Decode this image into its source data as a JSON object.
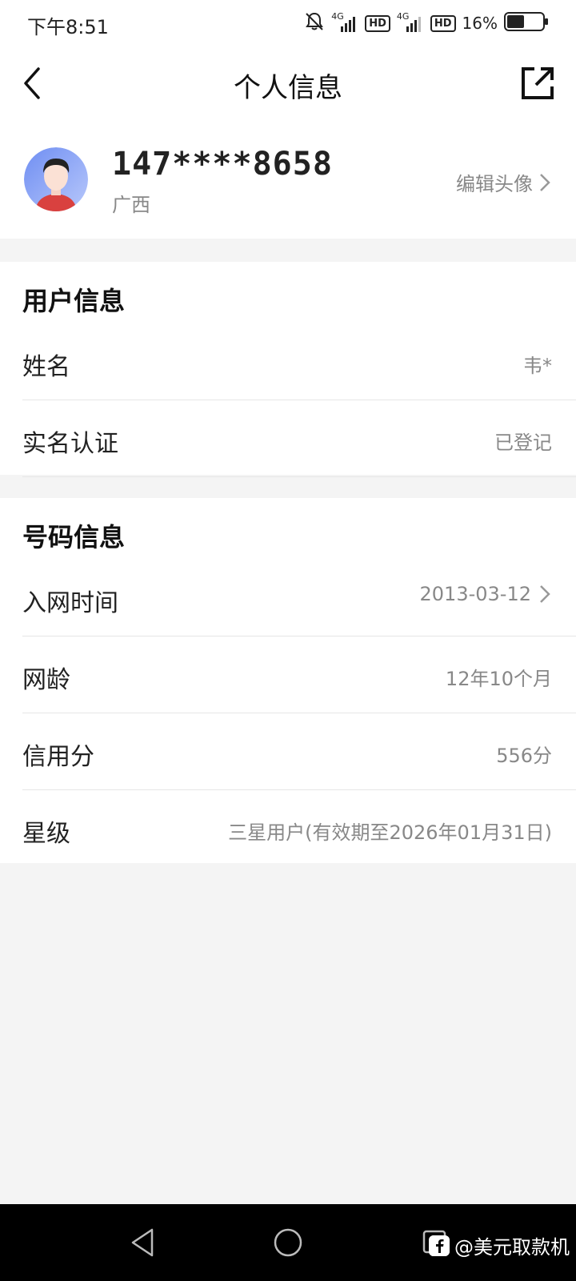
{
  "status_bar": {
    "time": "下午8:51",
    "battery_percent": "16%",
    "network_1": "4G",
    "network_2": "4G",
    "hd_1": "HD",
    "hd_2": "HD",
    "battery_level": 0.16
  },
  "header": {
    "title": "个人信息"
  },
  "profile": {
    "phone": "147****8658",
    "region": "广西",
    "edit_avatar_label": "编辑头像"
  },
  "user_info": {
    "title": "用户信息",
    "rows": [
      {
        "label": "姓名",
        "value": "韦*"
      },
      {
        "label": "实名认证",
        "value": "已登记"
      }
    ]
  },
  "number_info": {
    "title": "号码信息",
    "rows": [
      {
        "label": "入网时间",
        "value": "2013-03-12",
        "has_chevron": true
      },
      {
        "label": "网龄",
        "value": "12年10个月"
      },
      {
        "label": "信用分",
        "value": "556分"
      },
      {
        "label": "星级",
        "value": "三星用户(有效期至2026年01月31日)"
      }
    ]
  },
  "watermark": {
    "text": "@美元取款机"
  },
  "icons": [
    "back-arrow-icon",
    "share-icon",
    "chevron-right-icon",
    "mute-bell-icon",
    "signal-icon",
    "battery-icon",
    "nav-back-icon",
    "nav-home-icon",
    "nav-recents-icon"
  ]
}
